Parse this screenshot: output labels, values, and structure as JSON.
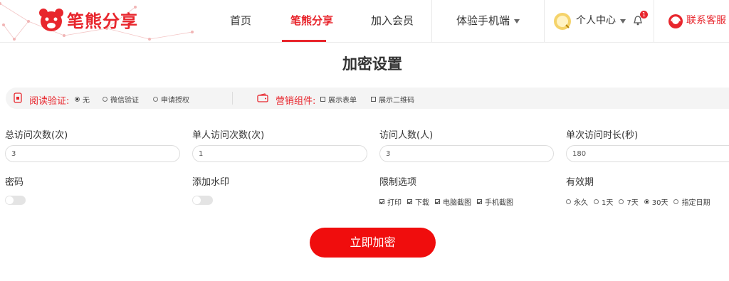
{
  "header": {
    "logo_text": "笔熊分享",
    "nav": [
      {
        "label": "首页"
      },
      {
        "label": "笔熊分享"
      },
      {
        "label": "加入会员"
      },
      {
        "label": "体验手机端"
      }
    ],
    "user_center": "个人中心",
    "notification_count": "1",
    "support": "联系客服"
  },
  "page": {
    "title": "加密设置"
  },
  "bar": {
    "read_verify_label": "阅读验证:",
    "read_verify_options": [
      "无",
      "微信验证",
      "申请授权"
    ],
    "read_verify_selected": "无",
    "marketing_label": "营销组件:",
    "marketing_options": [
      "展示表单",
      "展示二维码"
    ]
  },
  "fields": {
    "total_visits": {
      "label": "总访问次数(次)",
      "value": "3"
    },
    "single_visits": {
      "label": "单人访问次数(次)",
      "value": "1"
    },
    "visitors": {
      "label": "访问人数(人)",
      "value": "3"
    },
    "visit_duration": {
      "label": "单次访问时长(秒)",
      "value": "180"
    }
  },
  "password": {
    "label": "密码",
    "enabled": false
  },
  "watermark": {
    "label": "添加水印",
    "enabled": false
  },
  "restrictions": {
    "label": "限制选项",
    "options": [
      {
        "label": "打印",
        "checked": true
      },
      {
        "label": "下载",
        "checked": true
      },
      {
        "label": "电脑截图",
        "checked": true
      },
      {
        "label": "手机截图",
        "checked": true
      }
    ]
  },
  "validity": {
    "label": "有效期",
    "options": [
      "永久",
      "1天",
      "7天",
      "30天",
      "指定日期"
    ],
    "selected": "30天"
  },
  "submit_label": "立即加密",
  "colors": {
    "accent": "#e8262d",
    "button": "#f00d0d"
  }
}
